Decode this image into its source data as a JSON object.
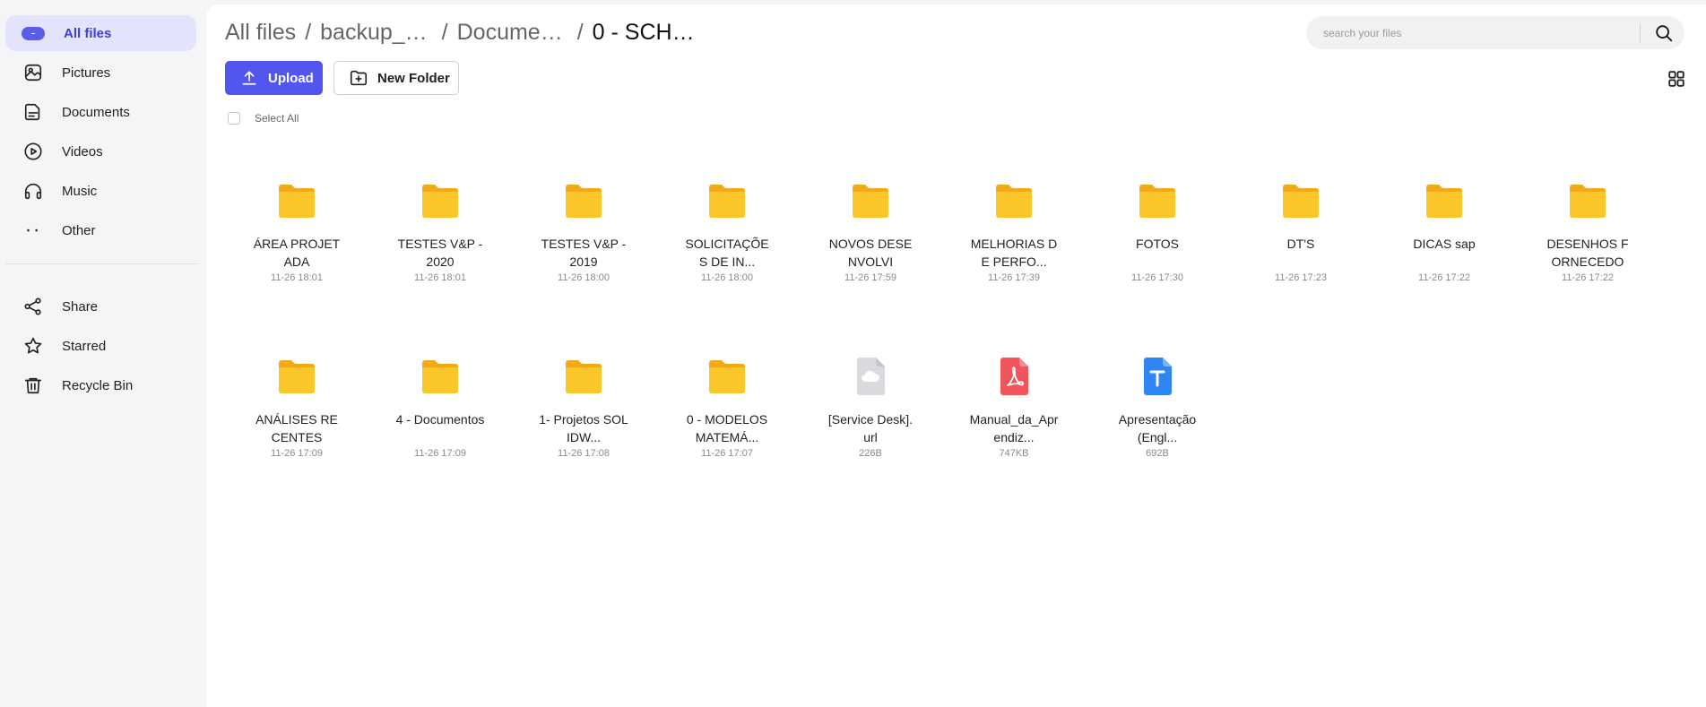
{
  "sidebar": {
    "items": [
      {
        "label": "All files",
        "icon": "all-files-icon",
        "active": true
      },
      {
        "label": "Pictures",
        "icon": "picture-icon"
      },
      {
        "label": "Documents",
        "icon": "document-icon"
      },
      {
        "label": "Videos",
        "icon": "play-icon"
      },
      {
        "label": "Music",
        "icon": "headphones-icon"
      },
      {
        "label": "Other",
        "icon": "more-icon"
      }
    ],
    "secondary": [
      {
        "label": "Share",
        "icon": "share-icon"
      },
      {
        "label": "Starred",
        "icon": "star-icon"
      },
      {
        "label": "Recycle Bin",
        "icon": "trash-icon"
      }
    ]
  },
  "breadcrumb": {
    "items": [
      "All files",
      "backup_…",
      "Docume…",
      "0 - SCH…"
    ],
    "separator": "/"
  },
  "search": {
    "placeholder": "search your files"
  },
  "toolbar": {
    "upload_label": "Upload",
    "new_folder_label": "New Folder"
  },
  "select_all_label": "Select All",
  "colors": {
    "accent": "#5356ee",
    "folder": "#fbc62a",
    "pdf": "#f2545b",
    "doc": "#2e86f5"
  },
  "files": [
    {
      "name": "ÁREA PROJETADA",
      "meta": "11-26 18:01",
      "type": "folder"
    },
    {
      "name": "TESTES V&P - 2020",
      "meta": "11-26 18:01",
      "type": "folder"
    },
    {
      "name": "TESTES V&P - 2019",
      "meta": "11-26 18:00",
      "type": "folder"
    },
    {
      "name": "SOLICITAÇÕES DE IN...",
      "meta": "11-26 18:00",
      "type": "folder"
    },
    {
      "name": "NOVOS DESENVOLVI",
      "meta": "11-26 17:59",
      "type": "folder"
    },
    {
      "name": "MELHORIAS DE PERFO...",
      "meta": "11-26 17:39",
      "type": "folder"
    },
    {
      "name": "FOTOS",
      "meta": "11-26 17:30",
      "type": "folder"
    },
    {
      "name": "DT'S",
      "meta": "11-26 17:23",
      "type": "folder"
    },
    {
      "name": "DICAS sap",
      "meta": "11-26 17:22",
      "type": "folder"
    },
    {
      "name": "DESENHOS FORNECEDO",
      "meta": "11-26 17:22",
      "type": "folder"
    },
    {
      "name": "ANÁLISES RECENTES",
      "meta": "11-26 17:09",
      "type": "folder"
    },
    {
      "name": "4 - Documentos",
      "meta": "11-26 17:09",
      "type": "folder"
    },
    {
      "name": "1- Projetos SOLIDW...",
      "meta": "11-26 17:08",
      "type": "folder"
    },
    {
      "name": "0 - MODELOS MATEMÁ...",
      "meta": "11-26 17:07",
      "type": "folder"
    },
    {
      "name": "[Service Desk].url",
      "meta": "226B",
      "type": "cloud"
    },
    {
      "name": "Manual_da_Aprendiz...",
      "meta": "747KB",
      "type": "pdf"
    },
    {
      "name": "Apresentação (Engl...",
      "meta": "692B",
      "type": "doc"
    }
  ]
}
